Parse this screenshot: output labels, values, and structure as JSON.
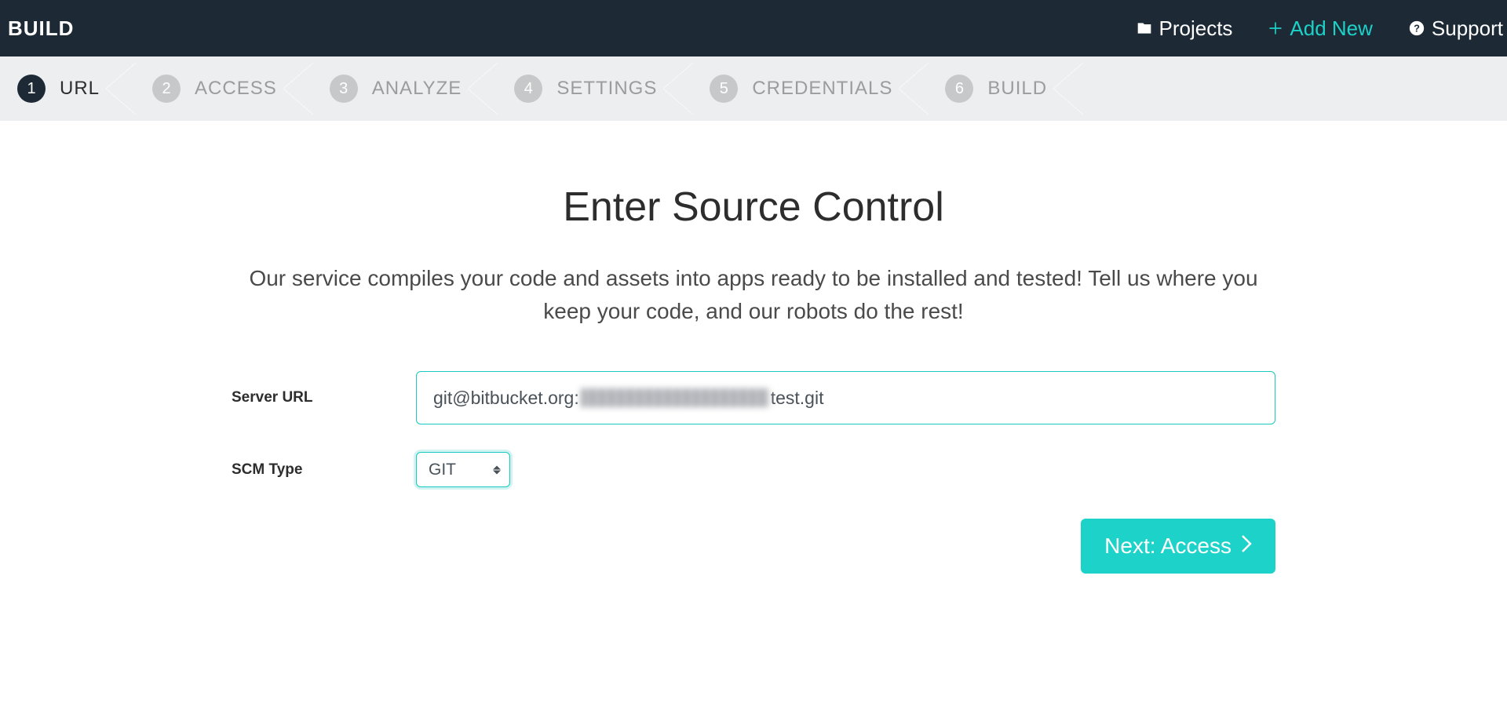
{
  "header": {
    "brand": "BUILD",
    "nav": {
      "projects": "Projects",
      "add_new": "Add New",
      "support": "Support"
    }
  },
  "steps": [
    {
      "num": "1",
      "label": "URL",
      "active": true
    },
    {
      "num": "2",
      "label": "ACCESS",
      "active": false
    },
    {
      "num": "3",
      "label": "ANALYZE",
      "active": false
    },
    {
      "num": "4",
      "label": "SETTINGS",
      "active": false
    },
    {
      "num": "5",
      "label": "CREDENTIALS",
      "active": false
    },
    {
      "num": "6",
      "label": "BUILD",
      "active": false
    }
  ],
  "main": {
    "title": "Enter Source Control",
    "subtitle": "Our service compiles your code and assets into apps ready to be installed and tested! Tell us where you keep your code, and our robots do the rest!",
    "form": {
      "server_url_label": "Server URL",
      "server_url_prefix": "git@bitbucket.org:",
      "server_url_suffix": "test.git",
      "scm_type_label": "SCM Type",
      "scm_type_value": "GIT"
    },
    "next_label": "Next: Access"
  },
  "colors": {
    "accent": "#1dd3c9",
    "navbar": "#1d2a36"
  }
}
